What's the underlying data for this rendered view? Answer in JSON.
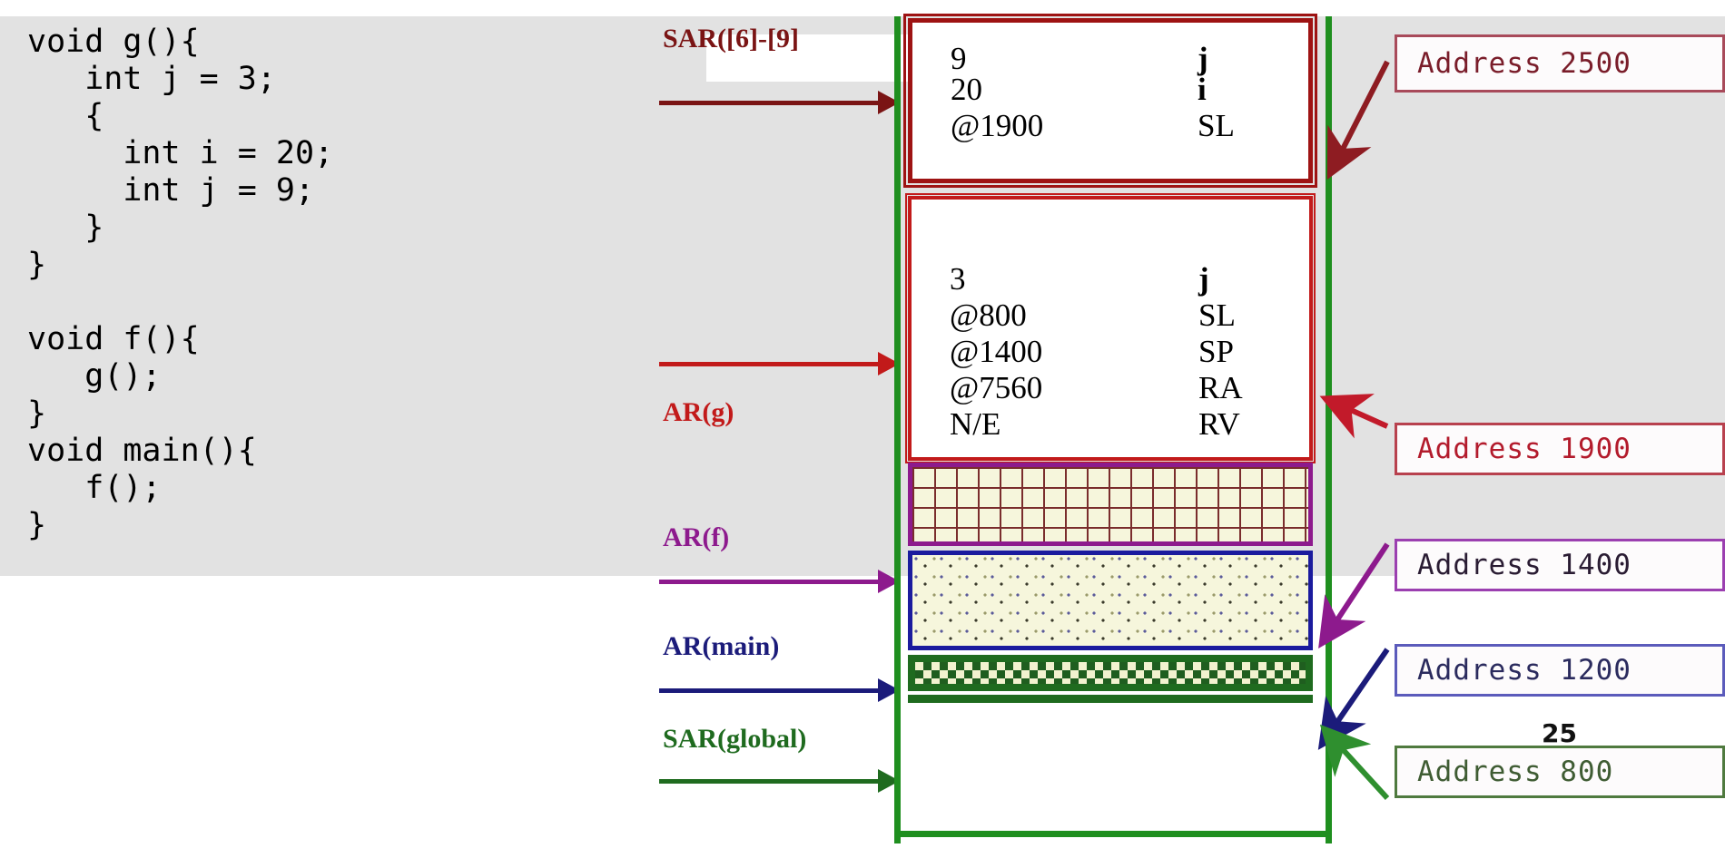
{
  "code": {
    "text": "void g(){\n   int j = 3;\n   {\n     int i = 20;\n     int j = 9;\n   }\n}\n\nvoid f(){\n   g();\n}\nvoid main(){\n   f();\n}"
  },
  "pointers": [
    {
      "label": "SAR([6]-[9]",
      "color": "#7a1414"
    },
    {
      "label": "AR(g)",
      "color": "#c21a1a"
    },
    {
      "label": "AR(f)",
      "color": "#8d1a8d"
    },
    {
      "label": "AR(main)",
      "color": "#1b1b7a"
    },
    {
      "label": "SAR(global)",
      "color": "#1f6b1f"
    }
  ],
  "frames": {
    "sar_block": {
      "name": "SAR([6]-[9]",
      "border_color": "#9e1313",
      "rows": [
        {
          "value": "9",
          "name": "j"
        },
        {
          "value": "20",
          "name": "i"
        },
        {
          "value": "@1900",
          "name": "SL"
        }
      ]
    },
    "ar_g_block": {
      "name": "AR(g)",
      "border_color": "#c21a1a",
      "rows": [
        {
          "value": "3",
          "name": "j"
        },
        {
          "value": "@800",
          "name": "SL"
        },
        {
          "value": "@1400",
          "name": "SP"
        },
        {
          "value": "@7560",
          "name": "RA"
        },
        {
          "value": "N/E",
          "name": "RV"
        }
      ]
    },
    "ar_f_block": {
      "name": "AR(f)",
      "border_color": "#8d1a8d",
      "fill": "#f6f6dc"
    },
    "ar_main_block": {
      "name": "AR(main)",
      "border_color": "#1b1b9e",
      "fill": "#f6f6dc"
    },
    "sar_global_block": {
      "name": "SAR(global)",
      "border_color": "#1f6b1f",
      "fill": "#f2f2cf"
    }
  },
  "addresses": [
    {
      "label": "Address 2500",
      "border_color": "#a84a5a",
      "text_color": "#7a1d2a"
    },
    {
      "label": "Address 1900",
      "border_color": "#b8414e",
      "text_color": "#b31b2c"
    },
    {
      "label": "Address 1400",
      "border_color": "#9b3fb0",
      "text_color": "#2a1c33"
    },
    {
      "label": "Address 1200",
      "border_color": "#5b5bbb",
      "text_color": "#2b2b5e"
    },
    {
      "label": "Address 800",
      "border_color": "#4f7a3f",
      "text_color": "#3f5c33"
    }
  ],
  "annotations": {
    "global_value": "25"
  },
  "stack_outline_color": "#1f8f1f"
}
